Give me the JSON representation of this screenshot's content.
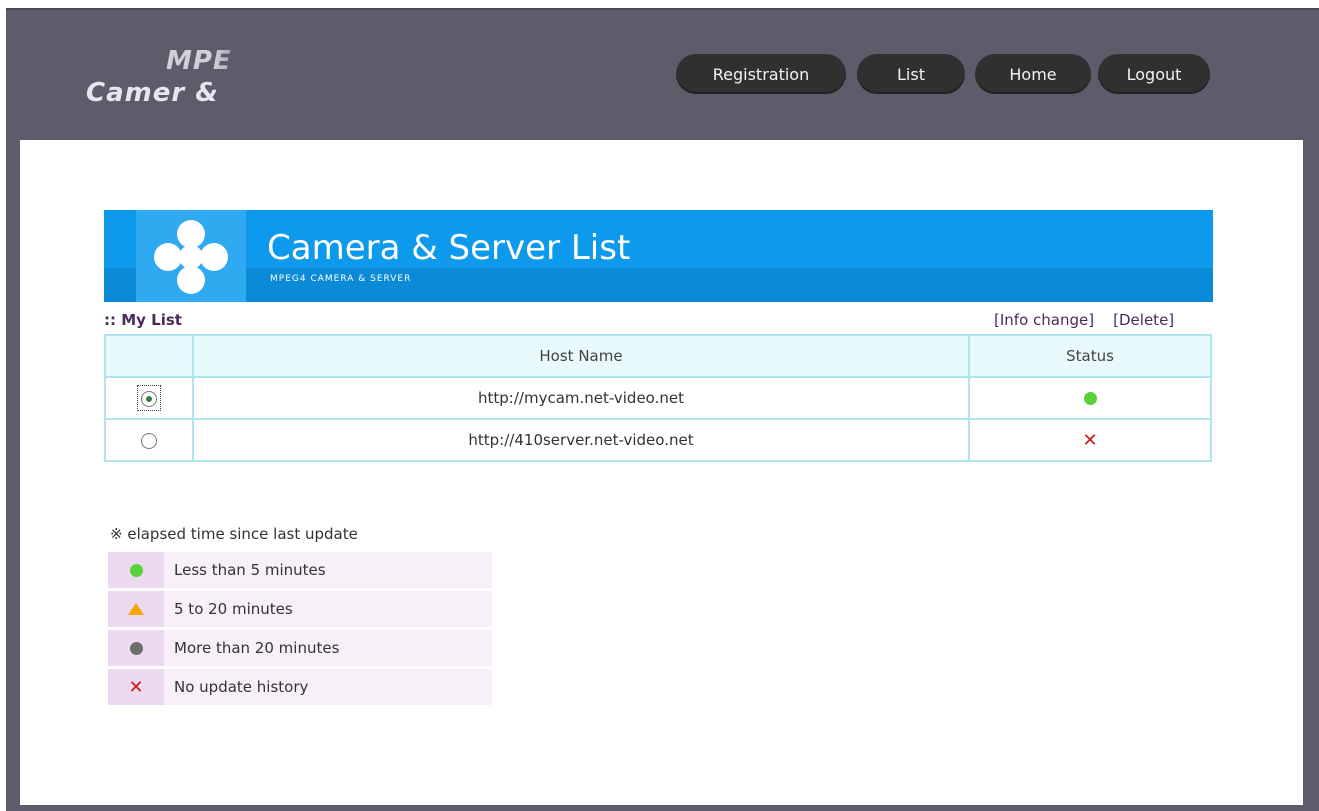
{
  "logo": {
    "line1": "MPE",
    "line2": "Camer &"
  },
  "nav": [
    {
      "label": "Registration"
    },
    {
      "label": "List"
    },
    {
      "label": "Home"
    },
    {
      "label": "Logout"
    }
  ],
  "banner": {
    "title": "Camera & Server List",
    "subtitle": "MPEG4 CAMERA & SERVER"
  },
  "mylist": {
    "title": ":: My List",
    "info_change": "[Info change]",
    "delete": "[Delete]"
  },
  "table": {
    "headers": [
      "",
      "Host Name",
      "Status"
    ],
    "rows": [
      {
        "selected": true,
        "host": "http://mycam.net-video.net",
        "status": "green-dot"
      },
      {
        "selected": false,
        "host": "http://410server.net-video.net",
        "status": "red-x"
      }
    ]
  },
  "legend": {
    "title": "※ elapsed time since last update",
    "items": [
      {
        "icon": "green-dot",
        "text": "Less than 5 minutes"
      },
      {
        "icon": "orange-triangle",
        "text": "5 to 20 minutes"
      },
      {
        "icon": "gray-dot",
        "text": "More than 20 minutes"
      },
      {
        "icon": "red-x",
        "text": "No update history"
      }
    ]
  },
  "status_mark": "✕",
  "colors": {
    "banner": "#0d99ec",
    "green": "#5ad03a",
    "orange": "#f5a800",
    "gray": "#6d6d6d",
    "red": "#cc1a1a",
    "frame": "#5e5c6b"
  }
}
